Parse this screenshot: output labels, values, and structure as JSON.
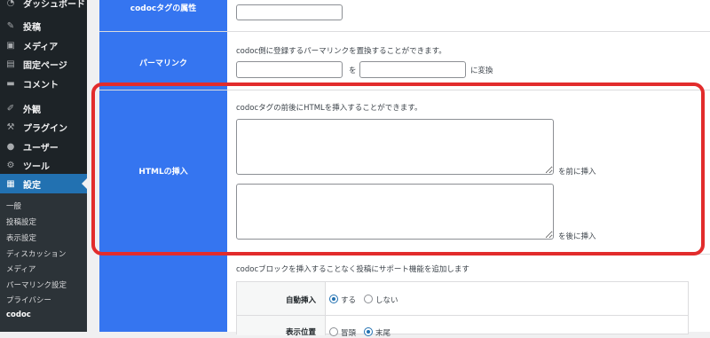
{
  "sidebar": {
    "items": [
      {
        "label": "ダッシュボード",
        "icon": "dashboard-icon",
        "glyph": "◔"
      },
      {
        "label": "投稿",
        "icon": "pin-icon",
        "glyph": "✎"
      },
      {
        "label": "メディア",
        "icon": "media-icon",
        "glyph": "▣"
      },
      {
        "label": "固定ページ",
        "icon": "pages-icon",
        "glyph": "▤"
      },
      {
        "label": "コメント",
        "icon": "comment-icon",
        "glyph": "▬"
      },
      {
        "label": "外観",
        "icon": "appearance-icon",
        "glyph": "✐"
      },
      {
        "label": "プラグイン",
        "icon": "plugin-icon",
        "glyph": "⚒"
      },
      {
        "label": "ユーザー",
        "icon": "user-icon",
        "glyph": "●"
      },
      {
        "label": "ツール",
        "icon": "wrench-icon",
        "glyph": "⚙"
      },
      {
        "label": "設定",
        "icon": "settings-icon",
        "glyph": "▦"
      }
    ],
    "submenu": [
      "一般",
      "投稿設定",
      "表示設定",
      "ディスカッション",
      "メディア",
      "パーマリンク設定",
      "プライバシー",
      "codoc"
    ]
  },
  "form": {
    "attr_label": "codocタグの属性",
    "permalink_label": "パーマリンク",
    "permalink_desc": "codoc側に登録するパーマリンクを置換することができます。",
    "permalink_from": "",
    "permalink_to_word": "を",
    "permalink_suffix": "に変換",
    "html_label": "HTMLの挿入",
    "html_desc": "codocタグの前後にHTMLを挿入することができます。",
    "before_label": "を前に挿入",
    "after_label": "を後に挿入",
    "block_desc": "codocブロックを挿入することなく投稿にサポート機能を追加します",
    "auto_insert_label": "自動挿入",
    "opt_yes": "する",
    "opt_no": "しない",
    "display_label": "表示位置",
    "opt_top": "冒頭",
    "opt_end": "末尾"
  },
  "colors": {
    "accent": "#3575f0",
    "highlight": "#e22c2c",
    "sidebar": "#1d2327",
    "active": "#2271b1"
  }
}
